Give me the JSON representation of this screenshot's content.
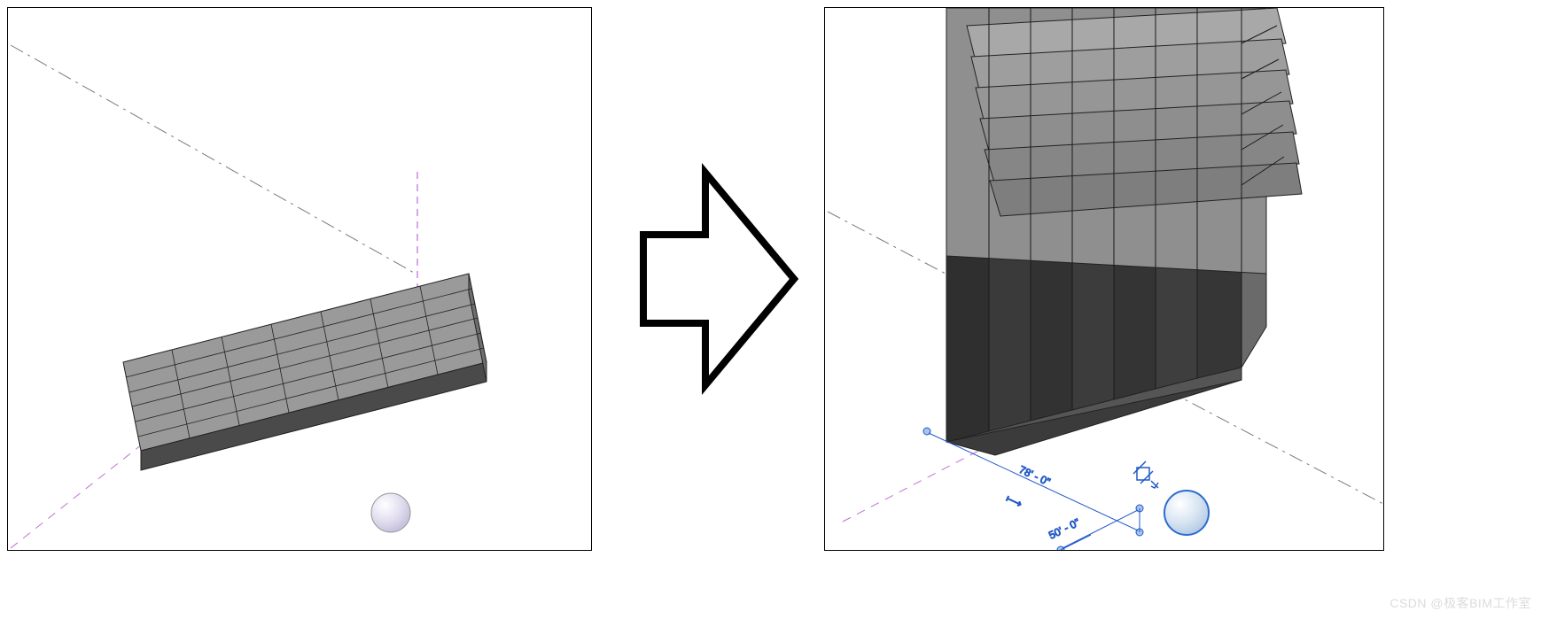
{
  "left_view": {
    "grid_cols": 7,
    "grid_rows": 6,
    "tile_thickness": "thin"
  },
  "right_view": {
    "grid_cols": 7,
    "grid_rows": 6,
    "columns": "randomized-height",
    "dimensions": {
      "dim1": "78' - 0\"",
      "dim2": "50' - 0\""
    }
  },
  "arrow": {
    "direction": "right"
  },
  "watermark": "CSDN @极客BIM工作室"
}
